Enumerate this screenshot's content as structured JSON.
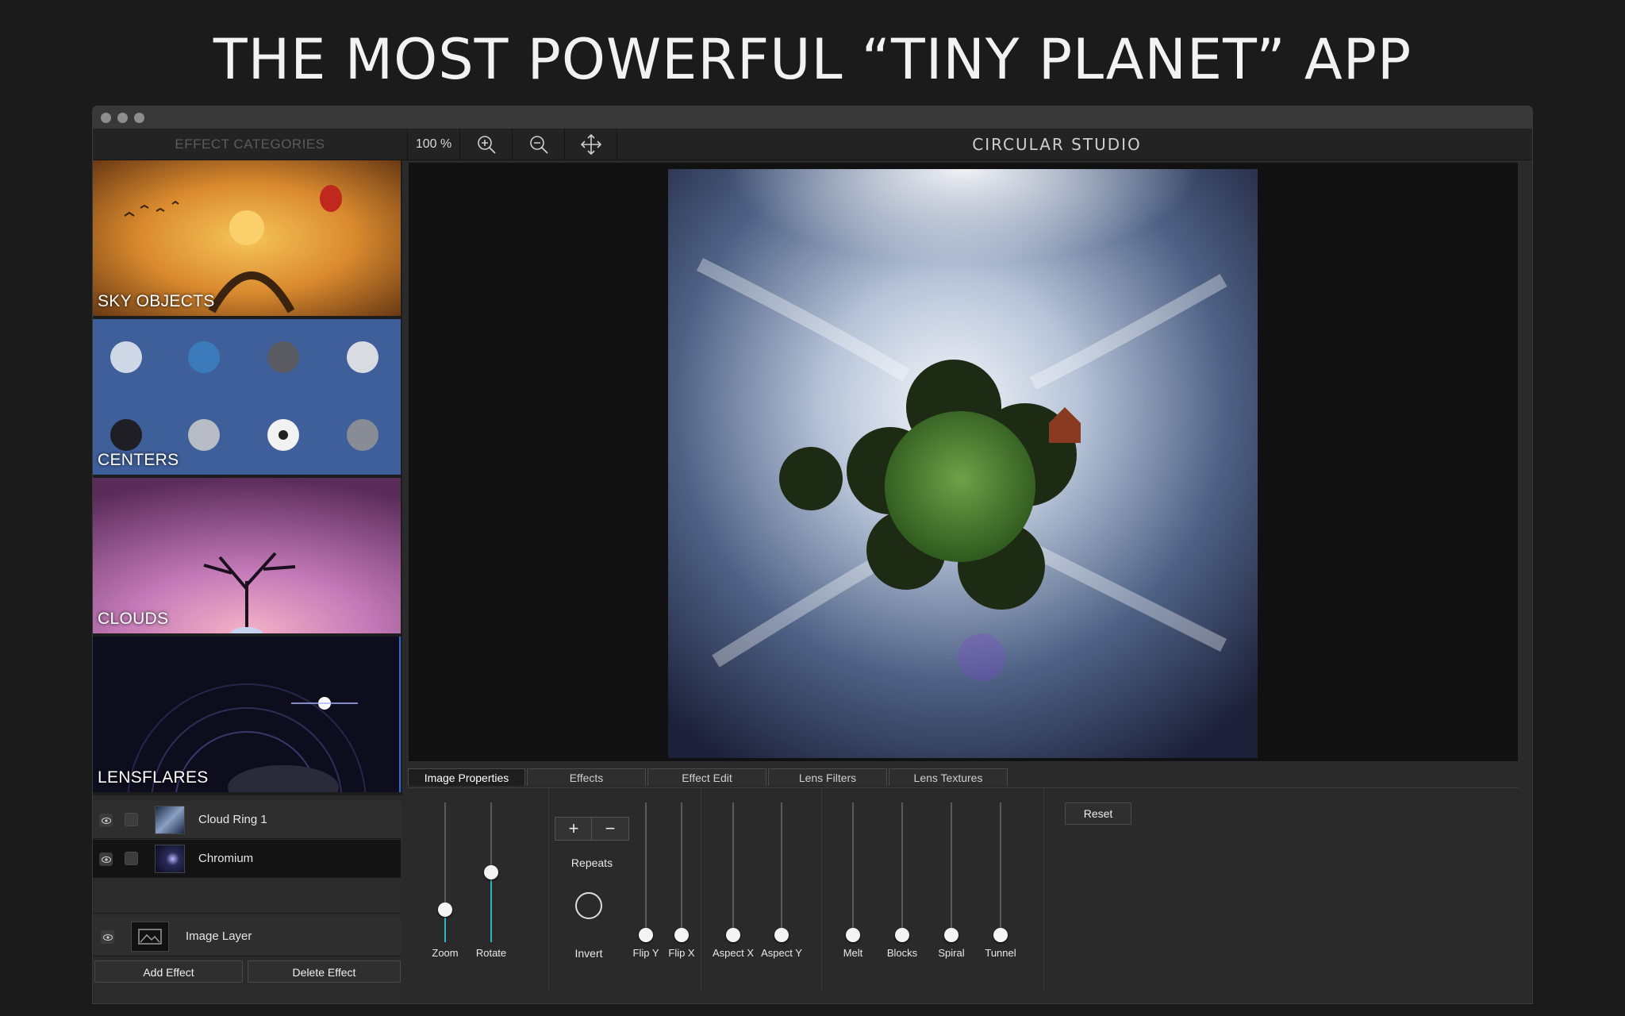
{
  "headline": "THE MOST POWERFUL “TINY PLANET” APP",
  "toolbar": {
    "categories_title": "EFFECT CATEGORIES",
    "zoom_value": "100 %",
    "zoom_in_icon": "zoom-in-icon",
    "zoom_out_icon": "zoom-out-icon",
    "move_icon": "move-icon",
    "app_name": "CIRCULAR STUDIO"
  },
  "categories": [
    {
      "label": "SKY OBJECTS"
    },
    {
      "label": "CENTERS"
    },
    {
      "label": "CLOUDS"
    },
    {
      "label": "LENSFLARES"
    }
  ],
  "layers": [
    {
      "name": "Cloud Ring 1"
    },
    {
      "name": "Chromium"
    }
  ],
  "image_layer": {
    "name": "Image Layer"
  },
  "buttons": {
    "add_effect": "Add Effect",
    "delete_effect": "Delete Effect",
    "reset": "Reset"
  },
  "tabs": [
    "Image Properties",
    "Effects",
    "Effect Edit",
    "Lens Filters",
    "Lens Textures"
  ],
  "active_tab": "Image Properties",
  "properties": {
    "zoom": {
      "label": "Zoom",
      "value": 0.2
    },
    "rotate": {
      "label": "Rotate",
      "value": 0.5
    },
    "repeats": {
      "label": "Repeats",
      "plus": "+",
      "minus": "−"
    },
    "invert": {
      "label": "Invert"
    },
    "flip_y": {
      "label": "Flip Y",
      "value": 0
    },
    "flip_x": {
      "label": "Flip X",
      "value": 0
    },
    "aspect_x": {
      "label": "Aspect X",
      "value": 0
    },
    "aspect_y": {
      "label": "Aspect Y",
      "value": 0
    },
    "melt": {
      "label": "Melt",
      "value": 0
    },
    "blocks": {
      "label": "Blocks",
      "value": 0
    },
    "spiral": {
      "label": "Spiral",
      "value": 0
    },
    "tunnel": {
      "label": "Tunnel",
      "value": 0
    }
  },
  "colors": {
    "accent": "#2fb5c2",
    "background": "#1b1b1c"
  }
}
